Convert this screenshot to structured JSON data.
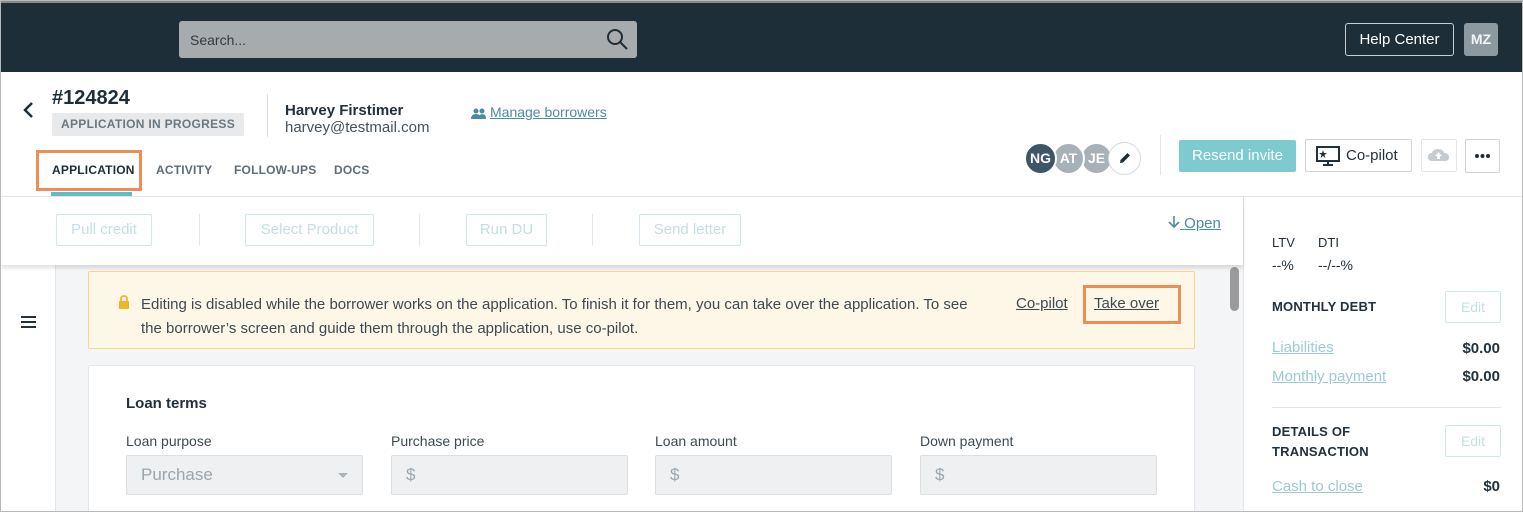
{
  "topbar": {
    "search_placeholder": "Search...",
    "help_label": "Help Center",
    "user_initials": "MZ"
  },
  "header": {
    "app_id": "#124824",
    "status": "APPLICATION IN PROGRESS",
    "borrower_name": "Harvey Firstimer",
    "borrower_email": "harvey@testmail.com",
    "manage_label": "Manage borrowers",
    "tabs": [
      {
        "label": "APPLICATION",
        "active": true
      },
      {
        "label": "ACTIVITY",
        "active": false
      },
      {
        "label": "FOLLOW-UPS",
        "active": false
      },
      {
        "label": "DOCS",
        "active": false
      }
    ],
    "team_avatars": [
      {
        "initials": "NG",
        "color": "#3d5567"
      },
      {
        "initials": "AT",
        "color": "#a7b1b8"
      },
      {
        "initials": "JE",
        "color": "#a7b1b8"
      }
    ],
    "resend_label": "Resend invite",
    "copilot_label": "Co-pilot"
  },
  "actions": {
    "buttons": [
      "Pull credit",
      "Select Product",
      "Run DU",
      "Send letter"
    ],
    "open_label": "Open"
  },
  "notice": {
    "text": "Editing is disabled while the borrower works on the application. To finish it for them, you can take over the application. To see the borrower’s screen and guide them through the application, use co-pilot.",
    "copilot_link": "Co-pilot",
    "takeover_link": "Take over"
  },
  "loan_terms": {
    "title": "Loan terms",
    "fields": [
      {
        "label": "Loan purpose",
        "value": "Purchase"
      },
      {
        "label": "Purchase price",
        "value": "$"
      },
      {
        "label": "Loan amount",
        "value": "$"
      },
      {
        "label": "Down payment",
        "value": "$"
      }
    ]
  },
  "sidebar": {
    "ltv_label": "LTV",
    "ltv_value": "--%",
    "dti_label": "DTI",
    "dti_value": "--/--%",
    "monthly_debt_title": "MONTHLY DEBT",
    "edit_label": "Edit",
    "liabilities_label": "Liabilities",
    "liabilities_value": "$0.00",
    "monthly_payment_label": "Monthly payment",
    "monthly_payment_value": "$0.00",
    "details_title_line1": "DETAILS OF",
    "details_title_line2": "TRANSACTION",
    "cash_to_close_label": "Cash to close",
    "cash_to_close_value": "$0"
  },
  "colors": {
    "topbar": "#1d2e38",
    "accent_teal": "#7dcacf",
    "link": "#4d8ba0",
    "highlight": "#ee8e57",
    "notice_bg": "#fdf7e8"
  }
}
